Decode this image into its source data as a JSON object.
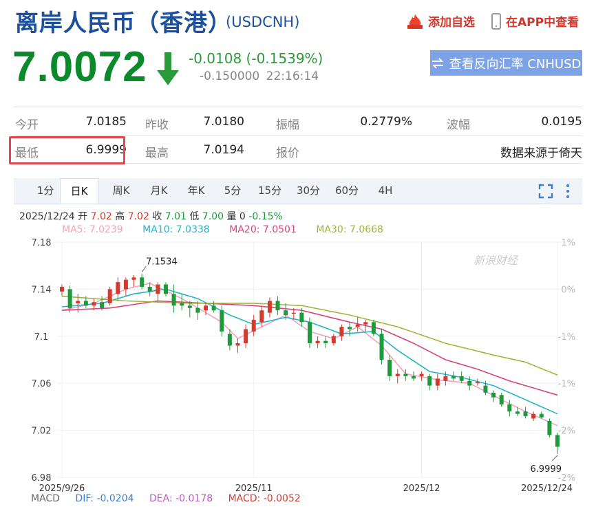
{
  "header": {
    "title": "离岸人民币（香港）",
    "symbol": "(USDCNH)",
    "add_watchlist": "添加自选",
    "view_in_app": "在APP中查看"
  },
  "quote": {
    "price": "7.0072",
    "change": "-0.0108 (-0.1539%)",
    "change_pips": "-0.150000",
    "time": "22:16:14",
    "reverse_button": "查看反向汇率 CNHUSD",
    "rows": [
      [
        {
          "label": "今开",
          "value": "7.0185"
        },
        {
          "label": "昨收",
          "value": "7.0180"
        },
        {
          "label": "振幅",
          "value": "0.2779%"
        },
        {
          "label": "波幅",
          "value": "0.0195"
        }
      ],
      [
        {
          "label": "最低",
          "value": "6.9999"
        },
        {
          "label": "最高",
          "value": "7.0194"
        },
        {
          "label": "报价",
          "value": "数据来源于倚天"
        }
      ]
    ]
  },
  "chart_tabs": [
    "1分",
    "日K",
    "周K",
    "月K",
    "年K",
    "5分",
    "15分",
    "30分",
    "60分",
    "4H"
  ],
  "active_tab": 1,
  "colors": {
    "up": "#d33b2f",
    "down": "#1e9a3c",
    "ma5": "#f4a3b8",
    "ma10": "#23b5c9",
    "ma20": "#d9437a",
    "ma30": "#a3b43a"
  },
  "chart_data": {
    "type": "candlestick",
    "ohlc_line": {
      "date": "2025/12/24",
      "open_label": "开",
      "open": "7.02",
      "high_label": "高",
      "high": "7.02",
      "close_label": "收",
      "close": "7.01",
      "low_label": "低",
      "low": "7.00",
      "volume_label": "量",
      "volume": "0",
      "change": "-0.15%"
    },
    "ma_labels": [
      {
        "key": "ma5",
        "text": "MA5: 7.0239"
      },
      {
        "key": "ma10",
        "text": "MA10: 7.0338"
      },
      {
        "key": "ma20",
        "text": "MA20: 7.0501"
      },
      {
        "key": "ma30",
        "text": "MA30: 7.0668"
      }
    ],
    "y_ticks": [
      "7.18",
      "7.14",
      "7.1",
      "7.06",
      "7.02",
      "6.98"
    ],
    "y_ticks_values": [
      7.18,
      7.14,
      7.1,
      7.06,
      7.02,
      6.98
    ],
    "pct_ticks": [
      "1%",
      "0%",
      "-1%",
      "-1%",
      "-2%",
      "-2%"
    ],
    "ylim": [
      6.98,
      7.18
    ],
    "x_ticks": [
      {
        "label": "2025/9/26",
        "index": 0
      },
      {
        "label": "2025/11",
        "index": 24
      },
      {
        "label": "2025/12",
        "index": 45
      },
      {
        "label": "2025/12/24",
        "index": 62
      }
    ],
    "annotations": [
      {
        "text": "7.1534",
        "index": 10,
        "value": 7.1534,
        "kind": "high"
      },
      {
        "text": "6.9999",
        "index": 62,
        "value": 6.9999,
        "kind": "low"
      }
    ],
    "watermark": "新浪财经",
    "candles": [
      {
        "o": 7.138,
        "h": 7.144,
        "l": 7.134,
        "c": 7.142
      },
      {
        "o": 7.14,
        "h": 7.143,
        "l": 7.12,
        "c": 7.124
      },
      {
        "o": 7.128,
        "h": 7.136,
        "l": 7.12,
        "c": 7.13
      },
      {
        "o": 7.13,
        "h": 7.134,
        "l": 7.124,
        "c": 7.126
      },
      {
        "o": 7.126,
        "h": 7.132,
        "l": 7.122,
        "c": 7.129
      },
      {
        "o": 7.129,
        "h": 7.134,
        "l": 7.122,
        "c": 7.124
      },
      {
        "o": 7.128,
        "h": 7.142,
        "l": 7.126,
        "c": 7.14
      },
      {
        "o": 7.136,
        "h": 7.15,
        "l": 7.13,
        "c": 7.146
      },
      {
        "o": 7.14,
        "h": 7.15,
        "l": 7.134,
        "c": 7.148
      },
      {
        "o": 7.148,
        "h": 7.152,
        "l": 7.142,
        "c": 7.15
      },
      {
        "o": 7.15,
        "h": 7.153,
        "l": 7.14,
        "c": 7.142
      },
      {
        "o": 7.142,
        "h": 7.146,
        "l": 7.134,
        "c": 7.138
      },
      {
        "o": 7.136,
        "h": 7.146,
        "l": 7.13,
        "c": 7.144
      },
      {
        "o": 7.144,
        "h": 7.146,
        "l": 7.134,
        "c": 7.136
      },
      {
        "o": 7.136,
        "h": 7.144,
        "l": 7.12,
        "c": 7.126
      },
      {
        "o": 7.128,
        "h": 7.136,
        "l": 7.122,
        "c": 7.126
      },
      {
        "o": 7.126,
        "h": 7.13,
        "l": 7.116,
        "c": 7.124
      },
      {
        "o": 7.124,
        "h": 7.13,
        "l": 7.114,
        "c": 7.12
      },
      {
        "o": 7.122,
        "h": 7.128,
        "l": 7.118,
        "c": 7.126
      },
      {
        "o": 7.126,
        "h": 7.13,
        "l": 7.12,
        "c": 7.122
      },
      {
        "o": 7.122,
        "h": 7.126,
        "l": 7.1,
        "c": 7.104
      },
      {
        "o": 7.102,
        "h": 7.106,
        "l": 7.088,
        "c": 7.092
      },
      {
        "o": 7.092,
        "h": 7.098,
        "l": 7.086,
        "c": 7.094
      },
      {
        "o": 7.094,
        "h": 7.11,
        "l": 7.09,
        "c": 7.106
      },
      {
        "o": 7.104,
        "h": 7.118,
        "l": 7.1,
        "c": 7.114
      },
      {
        "o": 7.112,
        "h": 7.126,
        "l": 7.108,
        "c": 7.122
      },
      {
        "o": 7.12,
        "h": 7.133,
        "l": 7.116,
        "c": 7.13
      },
      {
        "o": 7.13,
        "h": 7.134,
        "l": 7.118,
        "c": 7.122
      },
      {
        "o": 7.122,
        "h": 7.128,
        "l": 7.114,
        "c": 7.118
      },
      {
        "o": 7.12,
        "h": 7.124,
        "l": 7.114,
        "c": 7.12
      },
      {
        "o": 7.12,
        "h": 7.124,
        "l": 7.108,
        "c": 7.112
      },
      {
        "o": 7.112,
        "h": 7.116,
        "l": 7.09,
        "c": 7.094
      },
      {
        "o": 7.094,
        "h": 7.1,
        "l": 7.09,
        "c": 7.096
      },
      {
        "o": 7.096,
        "h": 7.1,
        "l": 7.09,
        "c": 7.094
      },
      {
        "o": 7.094,
        "h": 7.102,
        "l": 7.092,
        "c": 7.1
      },
      {
        "o": 7.1,
        "h": 7.11,
        "l": 7.096,
        "c": 7.108
      },
      {
        "o": 7.108,
        "h": 7.112,
        "l": 7.1,
        "c": 7.106
      },
      {
        "o": 7.108,
        "h": 7.116,
        "l": 7.104,
        "c": 7.11
      },
      {
        "o": 7.11,
        "h": 7.114,
        "l": 7.104,
        "c": 7.112
      },
      {
        "o": 7.112,
        "h": 7.114,
        "l": 7.1,
        "c": 7.102
      },
      {
        "o": 7.102,
        "h": 7.106,
        "l": 7.076,
        "c": 7.08
      },
      {
        "o": 7.08,
        "h": 7.084,
        "l": 7.062,
        "c": 7.066
      },
      {
        "o": 7.066,
        "h": 7.072,
        "l": 7.06,
        "c": 7.068
      },
      {
        "o": 7.068,
        "h": 7.072,
        "l": 7.062,
        "c": 7.066
      },
      {
        "o": 7.066,
        "h": 7.07,
        "l": 7.062,
        "c": 7.064
      },
      {
        "o": 7.066,
        "h": 7.07,
        "l": 7.062,
        "c": 7.068
      },
      {
        "o": 7.066,
        "h": 7.068,
        "l": 7.054,
        "c": 7.058
      },
      {
        "o": 7.058,
        "h": 7.068,
        "l": 7.054,
        "c": 7.064
      },
      {
        "o": 7.062,
        "h": 7.07,
        "l": 7.058,
        "c": 7.066
      },
      {
        "o": 7.066,
        "h": 7.07,
        "l": 7.062,
        "c": 7.064
      },
      {
        "o": 7.066,
        "h": 7.07,
        "l": 7.06,
        "c": 7.062
      },
      {
        "o": 7.062,
        "h": 7.066,
        "l": 7.054,
        "c": 7.058
      },
      {
        "o": 7.06,
        "h": 7.064,
        "l": 7.058,
        "c": 7.061
      },
      {
        "o": 7.058,
        "h": 7.062,
        "l": 7.05,
        "c": 7.052
      },
      {
        "o": 7.052,
        "h": 7.054,
        "l": 7.044,
        "c": 7.048
      },
      {
        "o": 7.05,
        "h": 7.052,
        "l": 7.04,
        "c": 7.042
      },
      {
        "o": 7.042,
        "h": 7.046,
        "l": 7.032,
        "c": 7.036
      },
      {
        "o": 7.036,
        "h": 7.04,
        "l": 7.032,
        "c": 7.034
      },
      {
        "o": 7.036,
        "h": 7.04,
        "l": 7.03,
        "c": 7.032
      },
      {
        "o": 7.03,
        "h": 7.036,
        "l": 7.028,
        "c": 7.034
      },
      {
        "o": 7.034,
        "h": 7.036,
        "l": 7.03,
        "c": 7.031
      },
      {
        "o": 7.028,
        "h": 7.03,
        "l": 7.014,
        "c": 7.016
      },
      {
        "o": 7.016,
        "h": 7.018,
        "l": 7.0,
        "c": 7.006
      }
    ],
    "ma_series": {
      "ma5": [
        [
          0,
          7.122
        ],
        [
          4,
          7.128
        ],
        [
          8,
          7.14
        ],
        [
          11,
          7.145
        ],
        [
          15,
          7.132
        ],
        [
          20,
          7.112
        ],
        [
          22,
          7.098
        ],
        [
          25,
          7.108
        ],
        [
          28,
          7.118
        ],
        [
          31,
          7.104
        ],
        [
          34,
          7.098
        ],
        [
          37,
          7.108
        ],
        [
          40,
          7.092
        ],
        [
          43,
          7.068
        ],
        [
          47,
          7.063
        ],
        [
          51,
          7.06
        ],
        [
          55,
          7.046
        ],
        [
          58,
          7.036
        ],
        [
          62,
          7.024
        ]
      ],
      "ma10": [
        [
          0,
          7.125
        ],
        [
          5,
          7.128
        ],
        [
          9,
          7.136
        ],
        [
          13,
          7.14
        ],
        [
          17,
          7.132
        ],
        [
          21,
          7.118
        ],
        [
          24,
          7.11
        ],
        [
          28,
          7.116
        ],
        [
          31,
          7.112
        ],
        [
          35,
          7.102
        ],
        [
          39,
          7.104
        ],
        [
          42,
          7.088
        ],
        [
          46,
          7.07
        ],
        [
          50,
          7.065
        ],
        [
          54,
          7.058
        ],
        [
          58,
          7.046
        ],
        [
          62,
          7.034
        ]
      ],
      "ma20": [
        [
          0,
          7.122
        ],
        [
          6,
          7.124
        ],
        [
          12,
          7.13
        ],
        [
          18,
          7.128
        ],
        [
          24,
          7.126
        ],
        [
          30,
          7.122
        ],
        [
          36,
          7.112
        ],
        [
          40,
          7.106
        ],
        [
          44,
          7.094
        ],
        [
          48,
          7.08
        ],
        [
          52,
          7.072
        ],
        [
          56,
          7.062
        ],
        [
          60,
          7.054
        ],
        [
          62,
          7.05
        ]
      ],
      "ma30": [
        [
          0,
          7.134
        ],
        [
          8,
          7.13
        ],
        [
          16,
          7.128
        ],
        [
          24,
          7.128
        ],
        [
          30,
          7.126
        ],
        [
          36,
          7.118
        ],
        [
          42,
          7.108
        ],
        [
          48,
          7.094
        ],
        [
          54,
          7.084
        ],
        [
          58,
          7.078
        ],
        [
          62,
          7.067
        ]
      ]
    },
    "macd": {
      "label": "MACD",
      "dif": "DIF: -0.0204",
      "dea": "DEA: -0.0178",
      "macd": "MACD: -0.0052"
    }
  }
}
